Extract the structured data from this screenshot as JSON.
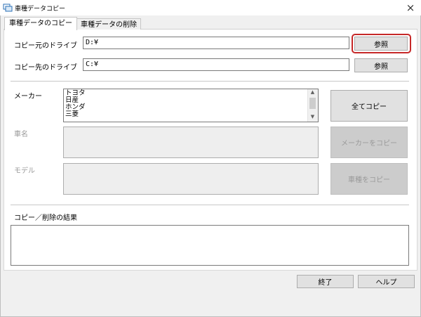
{
  "window": {
    "title": "車種データコピー",
    "close_glyph": "×"
  },
  "tabs": [
    {
      "label": "車種データのコピー",
      "active": true
    },
    {
      "label": "車種データの削除",
      "active": false
    }
  ],
  "copy_source": {
    "label": "コピー元のドライブ",
    "value": "D:¥",
    "browse_label": "参照"
  },
  "copy_dest": {
    "label": "コピー先のドライブ",
    "value": "C:¥",
    "browse_label": "参照"
  },
  "maker": {
    "label": "メーカー",
    "items": [
      "トヨタ",
      "日産",
      "ホンダ",
      "三菱"
    ]
  },
  "car_name": {
    "label": "車名"
  },
  "model": {
    "label": "モデル"
  },
  "buttons": {
    "copy_all": "全てコピー",
    "copy_maker": "メーカーをコピー",
    "copy_car": "車種をコピー",
    "exit": "終了",
    "help": "ヘルプ"
  },
  "result": {
    "label": "コピー／削除の結果",
    "value": ""
  },
  "colors": {
    "highlight": "#c62828",
    "disabled_text": "#9a9a9a"
  }
}
